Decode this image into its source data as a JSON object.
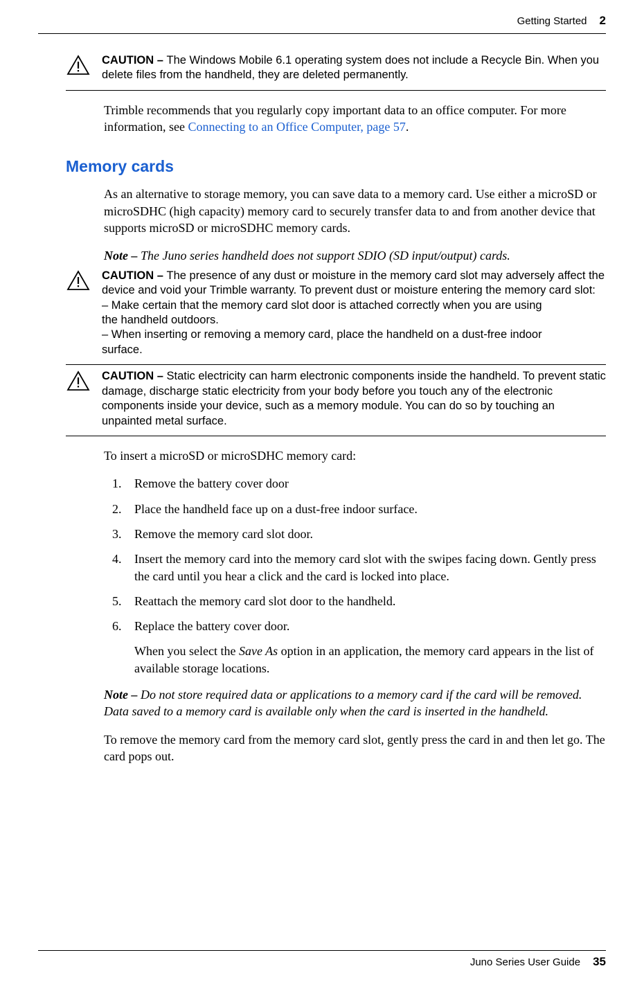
{
  "header": {
    "section": "Getting Started",
    "chapter": "2"
  },
  "caution1": {
    "label": "CAUTION – ",
    "text": "The Windows Mobile 6.1 operating system does not include a Recycle Bin. When you delete files from the handheld, they are deleted permanently."
  },
  "para1_a": "Trimble recommends that you regularly copy important data to an office computer. For more information, see ",
  "para1_link": "Connecting to an Office Computer, page 57",
  "para1_b": ".",
  "heading1": "Memory cards",
  "para2": "As an alternative to storage memory, you can save data to a memory card. Use either a microSD or  microSDHC (high capacity) memory card to securely transfer data to and from another device that supports microSD or microSDHC memory cards.",
  "note1": {
    "label": "Note – ",
    "text": "The Juno series handheld does not support SDIO (SD input/output) cards."
  },
  "caution2": {
    "label": "CAUTION – ",
    "text": "The presence of any dust or moisture in the memory card slot may adversely affect the device and void your Trimble warranty. To prevent dust or moisture entering the memory card slot:",
    "bullet1a": "– Make certain that the memory card slot door is attached correctly when you are using",
    "bullet1b": "the handheld outdoors.",
    "bullet2a": "– When inserting or removing a memory card, place the handheld on a dust-free indoor",
    "bullet2b": "surface."
  },
  "caution3": {
    "label": "CAUTION – ",
    "text": "Static electricity can harm electronic components inside the handheld. To prevent static damage, discharge static electricity from your body before you touch any of the electronic components inside your device, such as a memory module. You can do so by touching an unpainted metal surface."
  },
  "para3": "To insert a microSD or microSDHC memory card:",
  "steps": [
    "Remove the battery cover door",
    "Place the handheld face up on a dust-free indoor surface.",
    "Remove the memory card slot door.",
    "Insert the memory card into the memory card slot with the swipes facing down. Gently press the card until you hear a click and the card is locked into place.",
    "Reattach the memory card slot door to the handheld.",
    "Replace the battery cover door."
  ],
  "step6_sub_a": "When you select the ",
  "step6_sub_italic": "Save As",
  "step6_sub_b": " option in an application, the memory card appears in the list of available storage locations.",
  "note2": {
    "label": "Note – ",
    "text": "Do not store required data or applications to a memory card if the card will be removed. Data saved to a memory card is available only when the card is inserted in the handheld."
  },
  "para4": "To remove the memory card from the memory card slot, gently press the card in and then let go. The card pops out.",
  "footer": {
    "title": "Juno Series User Guide",
    "page": "35"
  }
}
